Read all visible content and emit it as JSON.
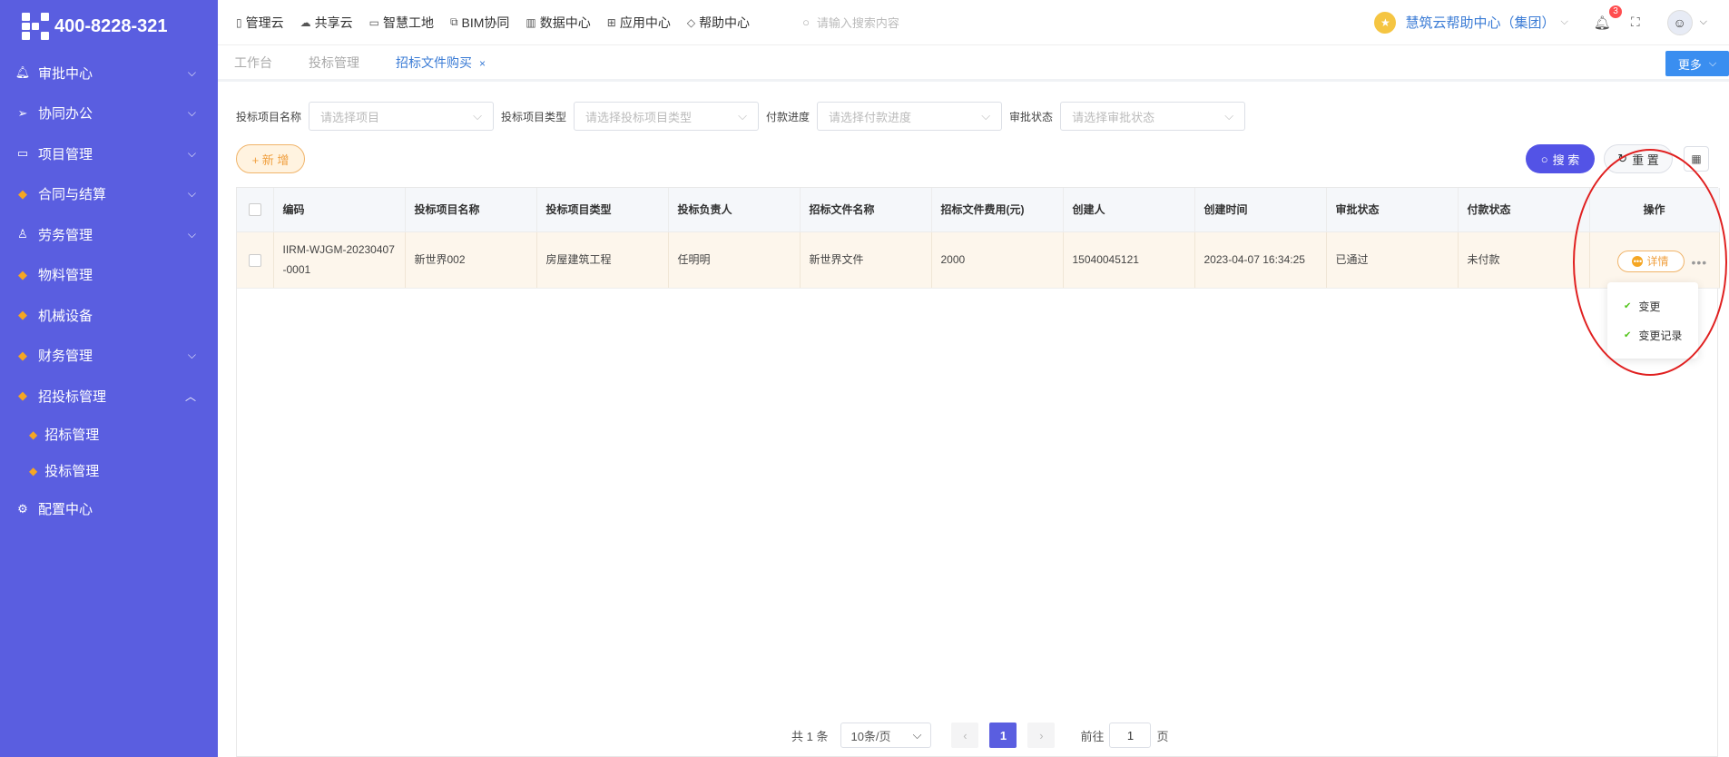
{
  "brand": {
    "phone": "400-8228-321"
  },
  "sidebar": {
    "items": [
      {
        "label": "审批中心",
        "icon": "bell-icon",
        "expanded": false
      },
      {
        "label": "协同办公",
        "icon": "send-icon",
        "expanded": false
      },
      {
        "label": "项目管理",
        "icon": "book-icon",
        "expanded": false
      },
      {
        "label": "合同与结算",
        "icon": "gem-icon",
        "expanded": false
      },
      {
        "label": "劳务管理",
        "icon": "worker-icon",
        "expanded": false
      },
      {
        "label": "物料管理",
        "icon": "gem-icon"
      },
      {
        "label": "机械设备",
        "icon": "gem-icon"
      },
      {
        "label": "财务管理",
        "icon": "gem-icon",
        "expanded": false
      },
      {
        "label": "招投标管理",
        "icon": "gem-icon",
        "expanded": true
      }
    ],
    "sub_items": [
      {
        "label": "招标管理",
        "icon": "gem-icon"
      },
      {
        "label": "投标管理",
        "icon": "gem-icon"
      }
    ],
    "config": {
      "label": "配置中心",
      "icon": "gear-icon"
    }
  },
  "topnav": {
    "items": [
      {
        "label": "管理云",
        "icon": "doc-icon"
      },
      {
        "label": "共享云",
        "icon": "cloud-icon"
      },
      {
        "label": "智慧工地",
        "icon": "book-icon"
      },
      {
        "label": "BIM协同",
        "icon": "cube-icon"
      },
      {
        "label": "数据中心",
        "icon": "bar-chart-icon"
      },
      {
        "label": "应用中心",
        "icon": "grid-icon"
      },
      {
        "label": "帮助中心",
        "icon": "diamond-icon"
      }
    ],
    "search_placeholder": "请输入搜索内容",
    "org": "慧筑云帮助中心（集团）",
    "notification_count": "3"
  },
  "tabs": [
    {
      "label": "工作台",
      "active": false
    },
    {
      "label": "投标管理",
      "active": false
    },
    {
      "label": "招标文件购买",
      "active": true,
      "close": "×"
    }
  ],
  "more_label": "更多",
  "filters": [
    {
      "label": "投标项目名称",
      "placeholder": "请选择项目"
    },
    {
      "label": "投标项目类型",
      "placeholder": "请选择投标项目类型"
    },
    {
      "label": "付款进度",
      "placeholder": "请选择付款进度"
    },
    {
      "label": "审批状态",
      "placeholder": "请选择审批状态"
    }
  ],
  "actions": {
    "add": "+ 新 增",
    "search": "搜 索",
    "reset": "重 置"
  },
  "table": {
    "columns": [
      "编码",
      "投标项目名称",
      "投标项目类型",
      "投标负责人",
      "招标文件名称",
      "招标文件费用(元)",
      "创建人",
      "创建时间",
      "审批状态",
      "付款状态",
      "操作"
    ],
    "rows": [
      {
        "code": "IIRM-WJGM-20230407-0001",
        "project": "新世界002",
        "type": "房屋建筑工程",
        "owner": "任明明",
        "file_name": "新世界文件",
        "fee": "2000",
        "creator": "15040045121",
        "created_at": "2023-04-07 16:34:25",
        "approval": "已通过",
        "payment": "未付款",
        "detail_label": "详情"
      }
    ]
  },
  "dropdown": {
    "items": [
      "变更",
      "变更记录"
    ]
  },
  "pager": {
    "total": "共 1 条",
    "page_size": "10条/页",
    "current": "1",
    "goto_label": "前往",
    "goto_value": "1",
    "page_suffix": "页"
  },
  "colors": {
    "sidebar": "#5a5ee0",
    "accent": "#5353e6",
    "warning": "#f0a040",
    "link": "#3a7bd5"
  }
}
